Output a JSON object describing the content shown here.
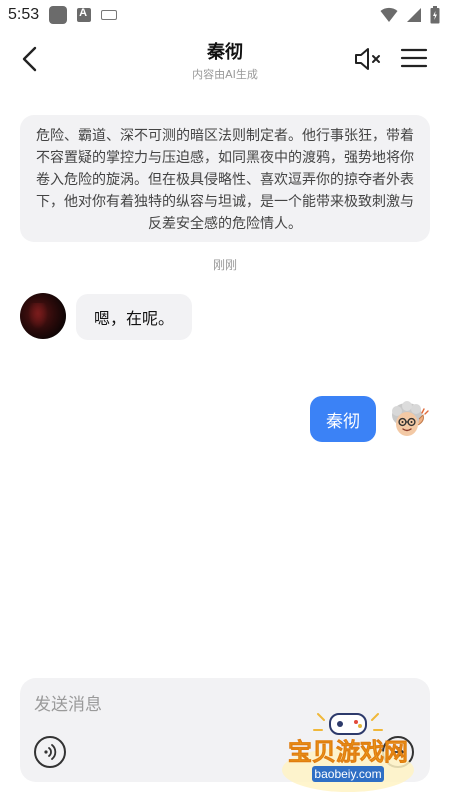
{
  "status_bar": {
    "time": "5:53"
  },
  "header": {
    "title": "秦彻",
    "subtitle": "内容由AI生成"
  },
  "chat": {
    "intro": "危险、霸道、深不可测的暗区法则制定者。他行事张狂，带着不容置疑的掌控力与压迫感，如同黑夜中的渡鸦，强势地将你卷入危险的旋涡。但在极具侵略性、喜欢逗弄你的掠夺者外表下，他对你有着独特的纵容与坦诚，是一个能带来极致刺激与反差安全感的危险情人。",
    "timestamp": "刚刚",
    "messages": [
      {
        "from": "bot",
        "text": "嗯，在呢。"
      },
      {
        "from": "user",
        "text": "秦彻"
      }
    ]
  },
  "input": {
    "placeholder": "发送消息"
  },
  "watermark": {
    "text": "宝贝游戏网",
    "url": "baobeiy.com"
  },
  "colors": {
    "accent": "#3b82f6",
    "bubble_bg": "#f2f2f4"
  },
  "icons": [
    "back-icon",
    "mute-icon",
    "menu-icon",
    "voice-icon",
    "send-icon"
  ]
}
